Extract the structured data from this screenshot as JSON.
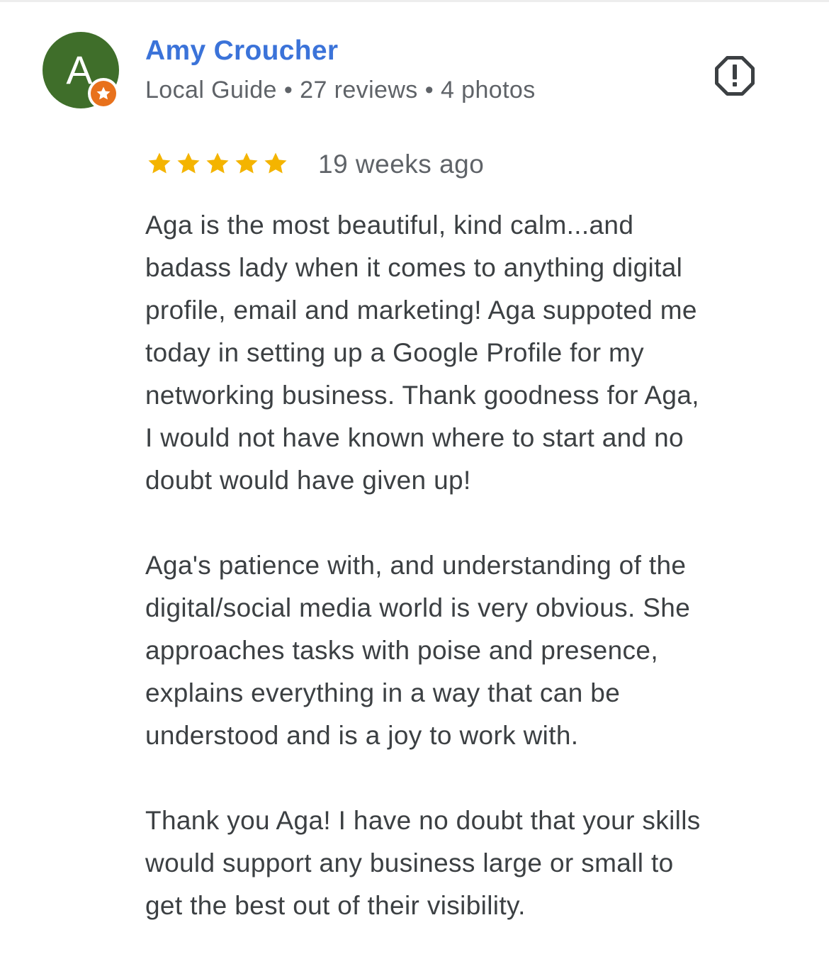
{
  "reviewer": {
    "name": "Amy Croucher",
    "avatar_letter": "A",
    "avatar_color": "#3f6e2a",
    "badge_color": "#e8711c",
    "badge_icon": "star-icon",
    "level": "Local Guide",
    "reviews": "27 reviews",
    "photos": "4 photos",
    "separator": "•"
  },
  "report_icon": "report-octagon-icon",
  "rating": {
    "stars": 5,
    "max": 5,
    "color": "#f4b400"
  },
  "time_ago": "19 weeks ago",
  "review": {
    "paragraph_1": [
      "Aga is the most beautiful, kind calm...and",
      "badass lady when it comes to anything digital",
      "profile, email and marketing! Aga suppoted me",
      "today in setting up a Google Profile for my",
      "networking business. Thank goodness for Aga,",
      "I would not have known where to start and no",
      "doubt would have given up!"
    ],
    "paragraph_2": [
      "Aga's patience with, and understanding of the",
      "digital/social media world is very obvious. She",
      "approaches tasks with poise and presence,",
      "explains everything in a way that can be",
      "understood and is a joy to work with."
    ],
    "paragraph_3": [
      "Thank you Aga! I have no doubt that your skills",
      "would support any business large or small to",
      "get the best out of their visibility."
    ]
  }
}
